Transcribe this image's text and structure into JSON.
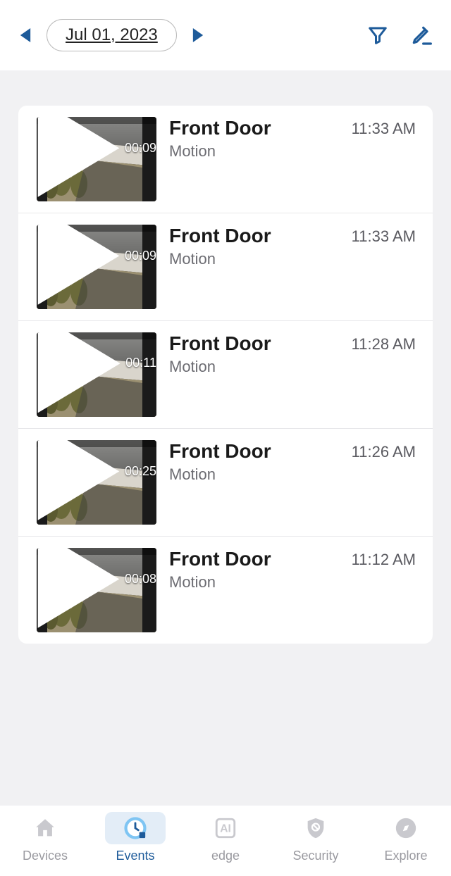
{
  "header": {
    "date": "Jul 01, 2023"
  },
  "events": [
    {
      "camera": "Front Door",
      "type": "Motion",
      "time": "11:33 AM",
      "duration": "00:09"
    },
    {
      "camera": "Front Door",
      "type": "Motion",
      "time": "11:33 AM",
      "duration": "00:09"
    },
    {
      "camera": "Front Door",
      "type": "Motion",
      "time": "11:28 AM",
      "duration": "00:11"
    },
    {
      "camera": "Front Door",
      "type": "Motion",
      "time": "11:26 AM",
      "duration": "00:25"
    },
    {
      "camera": "Front Door",
      "type": "Motion",
      "time": "11:12 AM",
      "duration": "00:08"
    }
  ],
  "nav": {
    "devices": "Devices",
    "events": "Events",
    "edge": "edge",
    "security": "Security",
    "explore": "Explore"
  },
  "colors": {
    "accent": "#1e5b9a"
  }
}
